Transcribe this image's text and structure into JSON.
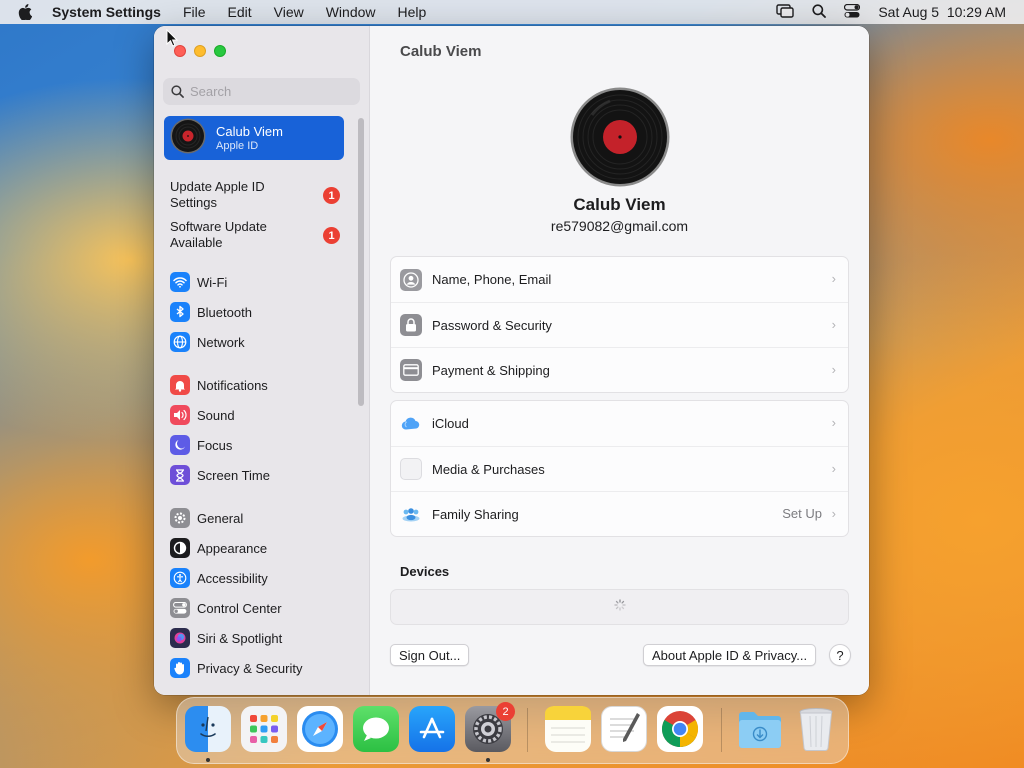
{
  "menubar": {
    "app_name": "System Settings",
    "items": [
      "File",
      "Edit",
      "View",
      "Window",
      "Help"
    ],
    "clock": "Sat Aug 5  10:29 AM"
  },
  "window": {
    "title": "Calub Viem",
    "search_placeholder": "Search",
    "account": {
      "name": "Calub Viem",
      "subtitle": "Apple ID"
    },
    "notices": [
      {
        "label": "Update Apple ID Settings",
        "badge": "1"
      },
      {
        "label": "Software Update Available",
        "badge": "1"
      }
    ],
    "sidebar_items": [
      {
        "label": "Wi-Fi",
        "icon": "wifi-icon",
        "color": "#1a82fb"
      },
      {
        "label": "Bluetooth",
        "icon": "bluetooth-icon",
        "color": "#1a82fb"
      },
      {
        "label": "Network",
        "icon": "globe-icon",
        "color": "#1a82fb"
      },
      {
        "label": "Notifications",
        "icon": "bell-icon",
        "color": "#f04a47"
      },
      {
        "label": "Sound",
        "icon": "speaker-icon",
        "color": "#f04a5c"
      },
      {
        "label": "Focus",
        "icon": "moon-icon",
        "color": "#5e5ce6"
      },
      {
        "label": "Screen Time",
        "icon": "hourglass-icon",
        "color": "#6e4fd8"
      },
      {
        "label": "General",
        "icon": "gear-icon",
        "color": "#8e8e93"
      },
      {
        "label": "Appearance",
        "icon": "appearance-icon",
        "color": "#1c1c1e"
      },
      {
        "label": "Accessibility",
        "icon": "accessibility-icon",
        "color": "#1a82fb"
      },
      {
        "label": "Control Center",
        "icon": "control-center-icon",
        "color": "#8e8e93"
      },
      {
        "label": "Siri & Spotlight",
        "icon": "siri-icon",
        "color": "#2c2c4e"
      },
      {
        "label": "Privacy & Security",
        "icon": "hand-icon",
        "color": "#1a82fb"
      }
    ]
  },
  "profile": {
    "name": "Calub Viem",
    "email": "re579082@gmail.com"
  },
  "groups": {
    "account": [
      {
        "label": "Name, Phone, Email",
        "icon": "contact-icon"
      },
      {
        "label": "Password & Security",
        "icon": "lock-icon"
      },
      {
        "label": "Payment & Shipping",
        "icon": "card-icon"
      }
    ],
    "services": [
      {
        "label": "iCloud",
        "icon": "icloud-icon",
        "extra": ""
      },
      {
        "label": "Media & Purchases",
        "icon": "media-icon",
        "extra": ""
      },
      {
        "label": "Family Sharing",
        "icon": "family-icon",
        "extra": "Set Up"
      }
    ]
  },
  "devices": {
    "label": "Devices"
  },
  "buttons": {
    "sign_out": "Sign Out...",
    "about": "About Apple ID & Privacy...",
    "help": "?"
  },
  "dock": {
    "apps": [
      "Finder",
      "Launchpad",
      "Safari",
      "Messages",
      "App Store",
      "System Settings",
      "Notes",
      "TextEdit",
      "Chrome",
      "Downloads",
      "Trash"
    ],
    "settings_badge": "2"
  }
}
